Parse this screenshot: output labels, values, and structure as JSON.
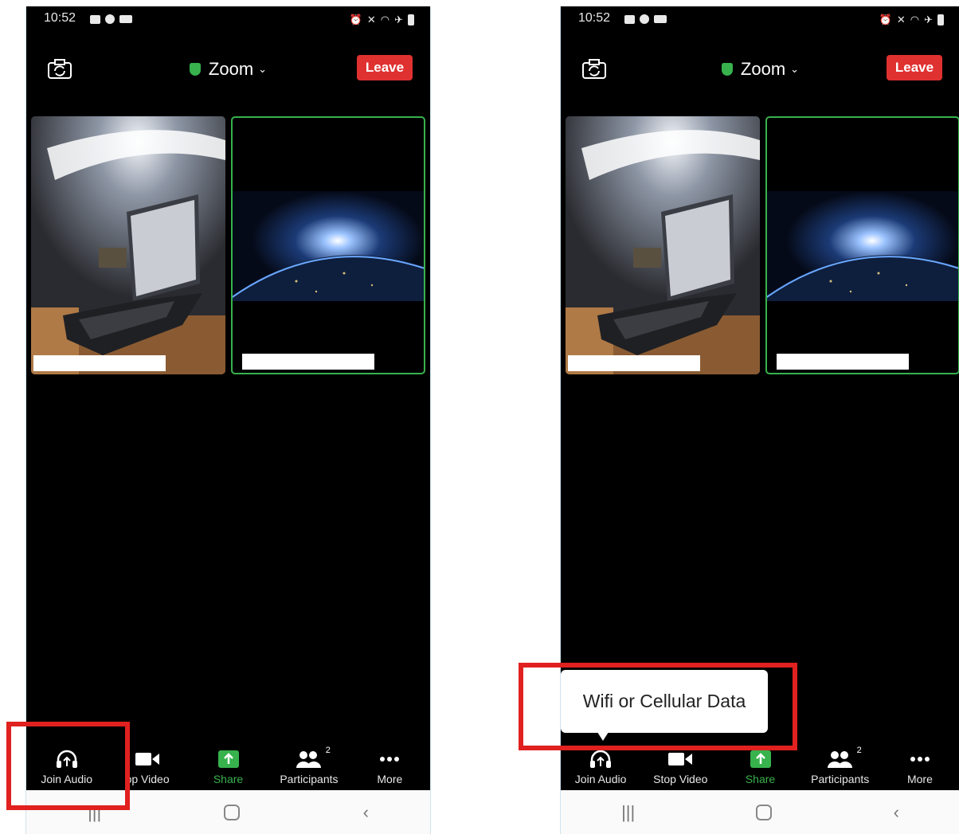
{
  "status_bar": {
    "time": "10:52"
  },
  "header": {
    "meeting_title": "Zoom",
    "leave_label": "Leave"
  },
  "toolbar": [
    {
      "key": "join_audio",
      "label": "Join Audio"
    },
    {
      "key": "stop_video",
      "label": "Stop Video"
    },
    {
      "key": "share",
      "label": "Share"
    },
    {
      "key": "participants",
      "label": "Participants",
      "count": "2"
    },
    {
      "key": "more",
      "label": "More"
    }
  ],
  "left_toolbar": {
    "stop_video_label": "op Video"
  },
  "popup": {
    "text": "Wifi or Cellular Data"
  },
  "colors": {
    "accent_green": "#37b24d",
    "leave_red": "#e03131",
    "highlight_red": "#e0211f"
  },
  "icons": {
    "camera_switch": "camera-switch-icon",
    "shield": "shield-icon",
    "headphones": "headphones-icon",
    "video": "video-camera-icon",
    "share": "share-icon",
    "participants": "participants-icon",
    "more": "more-icon"
  }
}
